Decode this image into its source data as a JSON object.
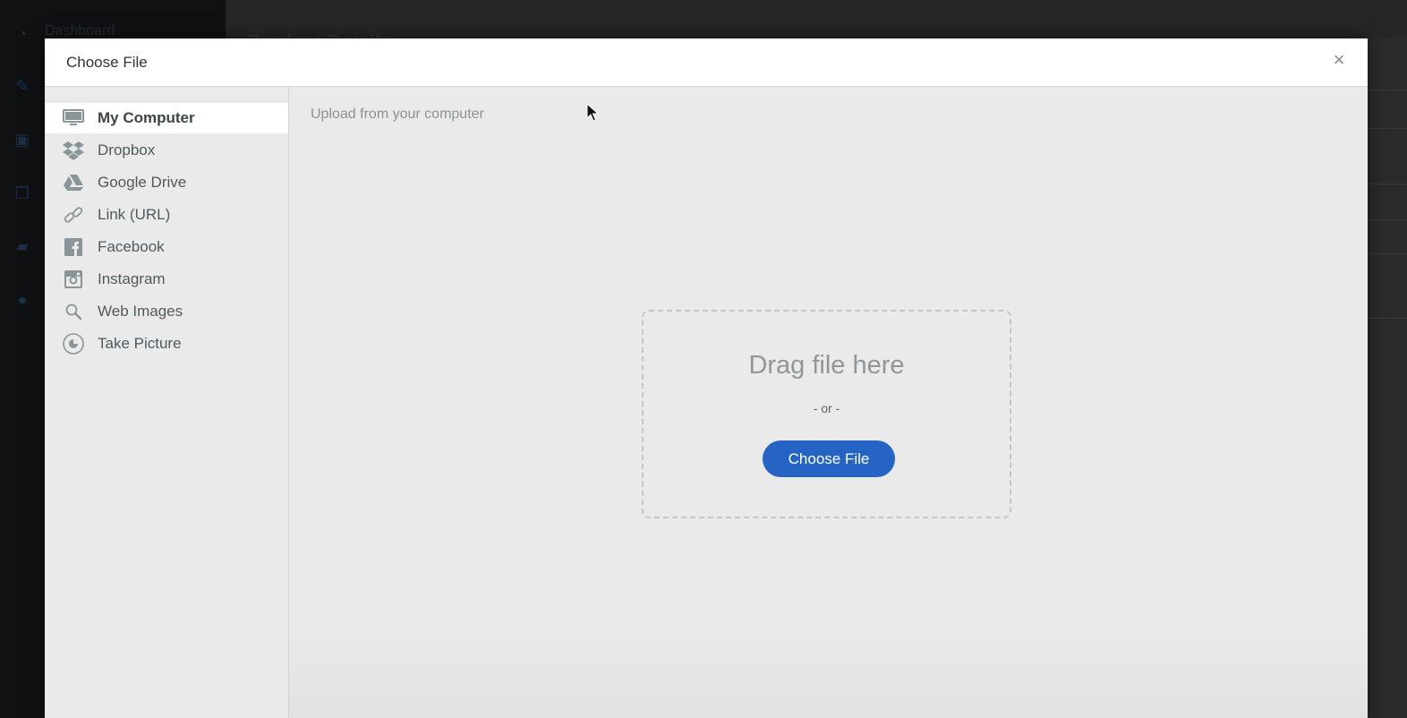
{
  "background": {
    "dashboard_label": "Dashboard",
    "page_title": "Product Details"
  },
  "modal": {
    "title": "Choose File",
    "close_icon": "×",
    "sources": [
      {
        "label": "My Computer",
        "icon": "monitor-icon",
        "active": true
      },
      {
        "label": "Dropbox",
        "icon": "dropbox-icon",
        "active": false
      },
      {
        "label": "Google Drive",
        "icon": "google-drive-icon",
        "active": false
      },
      {
        "label": "Link (URL)",
        "icon": "link-icon",
        "active": false
      },
      {
        "label": "Facebook",
        "icon": "facebook-icon",
        "active": false
      },
      {
        "label": "Instagram",
        "icon": "instagram-icon",
        "active": false
      },
      {
        "label": "Web Images",
        "icon": "search-icon",
        "active": false
      },
      {
        "label": "Take Picture",
        "icon": "camera-icon",
        "active": false
      }
    ],
    "content": {
      "heading": "Upload from your computer",
      "drop_title": "Drag file here",
      "drop_or": "- or -",
      "choose_button": "Choose File"
    }
  },
  "colors": {
    "accent": "#2563c4",
    "icon_gray": "#8a9599"
  }
}
